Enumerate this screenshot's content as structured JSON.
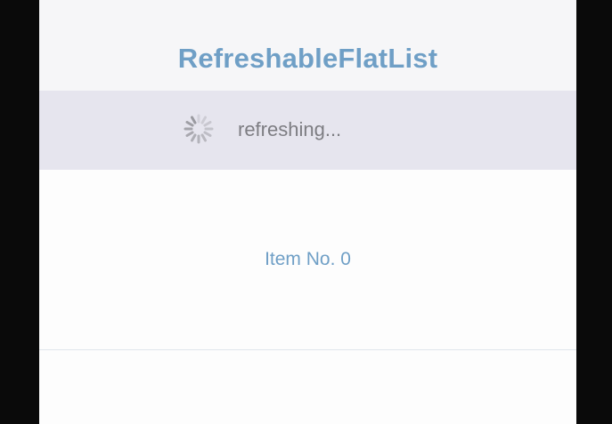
{
  "colors": {
    "accent": "#6f9fc6",
    "nav_background": "#f6f6f8",
    "refresh_background": "#e6e5ee",
    "refresh_text": "#7d7d82",
    "spinner": "#9a9aa0"
  },
  "header": {
    "title": "RefreshableFlatList"
  },
  "refresh": {
    "icon": "activity-spinner-icon",
    "status_text": "refreshing..."
  },
  "list": {
    "items": [
      {
        "label": "Item No. 0"
      }
    ]
  }
}
